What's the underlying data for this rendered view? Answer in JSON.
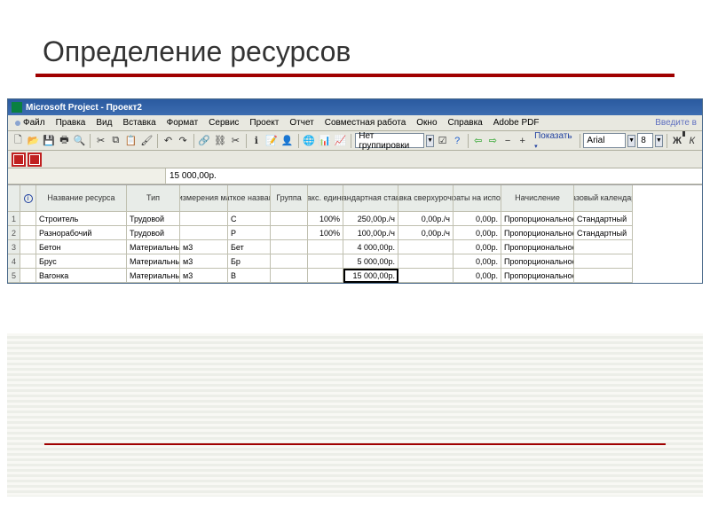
{
  "slide": {
    "title": "Определение ресурсов"
  },
  "app": {
    "title": "Microsoft Project - Проект2"
  },
  "menu": {
    "items": [
      "Файл",
      "Правка",
      "Вид",
      "Вставка",
      "Формат",
      "Сервис",
      "Проект",
      "Отчет",
      "Совместная работа",
      "Окно",
      "Справка",
      "Adobe PDF"
    ],
    "prompt": "Введите в"
  },
  "toolbar": {
    "grouping_label": "Нет группировки",
    "show_label": "Показать",
    "font_name": "Arial",
    "font_size": "8",
    "bold": "Ж",
    "italic": "К"
  },
  "formula": {
    "value": "15 000,00р."
  },
  "columns": {
    "info": "ℹ",
    "name": "Название ресурса",
    "type": "Тип",
    "units": "Единицы измерения материалов",
    "short": "Краткое название",
    "group": "Группа",
    "max": "Макс. единиц",
    "std_rate": "Стандартная ставка",
    "ot_rate": "Ставка сверхурочных",
    "cost_use": "Затраты на использ.",
    "accrue": "Начисление",
    "calendar": "Базовый календарь"
  },
  "rows": [
    {
      "n": "1",
      "name": "Строитель",
      "type": "Трудовой",
      "units": "",
      "short": "С",
      "group": "",
      "max": "100%",
      "std": "250,00р./ч",
      "ot": "0,00р./ч",
      "cu": "0,00р.",
      "accrue": "Пропорциональное",
      "cal": "Стандартный"
    },
    {
      "n": "2",
      "name": "Разнорабочий",
      "type": "Трудовой",
      "units": "",
      "short": "Р",
      "group": "",
      "max": "100%",
      "std": "100,00р./ч",
      "ot": "0,00р./ч",
      "cu": "0,00р.",
      "accrue": "Пропорциональное",
      "cal": "Стандартный"
    },
    {
      "n": "3",
      "name": "Бетон",
      "type": "Материальный",
      "units": "м3",
      "short": "Бет",
      "group": "",
      "max": "",
      "std": "4 000,00р.",
      "ot": "",
      "cu": "0,00р.",
      "accrue": "Пропорциональное",
      "cal": ""
    },
    {
      "n": "4",
      "name": "Брус",
      "type": "Материальный",
      "units": "м3",
      "short": "Бр",
      "group": "",
      "max": "",
      "std": "5 000,00р.",
      "ot": "",
      "cu": "0,00р.",
      "accrue": "Пропорциональное",
      "cal": ""
    },
    {
      "n": "5",
      "name": "Вагонка",
      "type": "Материальный",
      "units": "м3",
      "short": "В",
      "group": "",
      "max": "",
      "std": "15 000,00р.",
      "ot": "",
      "cu": "0,00р.",
      "accrue": "Пропорциональное",
      "cal": ""
    }
  ]
}
